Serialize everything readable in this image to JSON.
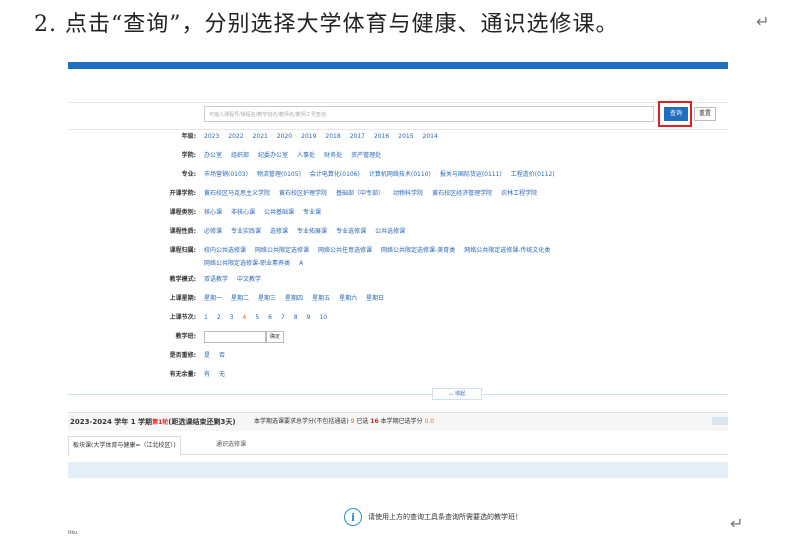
{
  "doc": {
    "step_text": "2. 点击“查询”，分别选择大学体育与健康、通识选修课。",
    "return_mark": "↵"
  },
  "search": {
    "placeholder": "可输入课程号/课程名/教学班名/教师名/教师工号查询",
    "query_label": "查询",
    "clear_label": "重置"
  },
  "filters": [
    {
      "label": "年级:",
      "options": [
        "2023",
        "2022",
        "2021",
        "2020",
        "2019",
        "2018",
        "2017",
        "2016",
        "2015",
        "2014"
      ]
    },
    {
      "label": "学院:",
      "options": [
        "办公室",
        "组织部",
        "纪委办公室",
        "人事处",
        "财务处",
        "资产管理处"
      ]
    },
    {
      "label": "专业:",
      "options": [
        "市场营销(0103)",
        "物流管理(0105)",
        "会计电算化(0106)",
        "计算机网络技术(0110)",
        "报关与国际货运(0111)",
        "工程造价(0112)"
      ]
    },
    {
      "label": "开课学院:",
      "options": [
        "黄石校区马克思主义学院",
        "黄石校区护理学院",
        "基础部（中专部）",
        "动物科学院",
        "黄石校区经济管理学院",
        "农林工程学院"
      ]
    },
    {
      "label": "课程类别:",
      "options": [
        "核心课",
        "非核心课",
        "公共基础课",
        "专业课"
      ]
    },
    {
      "label": "课程性质:",
      "options": [
        "必修课",
        "专业实践课",
        "选修课",
        "专业拓展课",
        "专业选修课",
        "公共选修课"
      ]
    },
    {
      "label": "课程归属:",
      "options": [
        "校内公共选修课",
        "网络公共限定选修课",
        "网络公共任意选修课",
        "网络公共限定选修课-美育类",
        "网络公共限定选修课-传统文化类"
      ]
    },
    {
      "label": "",
      "options": [
        "网络公共限定选修课-职业素养类",
        "A"
      ]
    },
    {
      "label": "教学模式:",
      "options": [
        "双语教学",
        "中文教学"
      ]
    },
    {
      "label": "上课星期:",
      "options": [
        "星期一",
        "星期二",
        "星期三",
        "星期四",
        "星期五",
        "星期六",
        "星期日"
      ]
    },
    {
      "label": "上课节次:",
      "options": [
        "1",
        "2",
        "3",
        "4",
        "5",
        "6",
        "7",
        "8",
        "9",
        "10"
      ],
      "selected_index": 3
    },
    {
      "label": "教学班:",
      "type": "input",
      "button": "确定"
    },
    {
      "label": "是否重修:",
      "options": [
        "是",
        "否"
      ]
    },
    {
      "label": "有无余量:",
      "options": [
        "有",
        "无"
      ]
    }
  ],
  "collapse_label": "︿ 收起",
  "info": {
    "term_prefix": "2023-2024 学年 1 学期",
    "term_suffix": "(距选课结束还剩3天)",
    "remaining_days_label": "第1轮",
    "stats_prefix": "本学期选课要求总学分(不包括通选)",
    "stats_value1": "9",
    "stats_mid": "已选",
    "stats_value2": "16",
    "stats_suffix": "本学期已选学分",
    "stats_value3": "0.0"
  },
  "tabs": [
    {
      "label": "板块课(大学体育与健康=（江北校区）)"
    },
    {
      "label": "通识选修课"
    }
  ],
  "hint": {
    "icon": "info-icon",
    "text": "请使用上方的查询工具条查询所需要选的教学班！"
  },
  "corner_note": "tiku"
}
